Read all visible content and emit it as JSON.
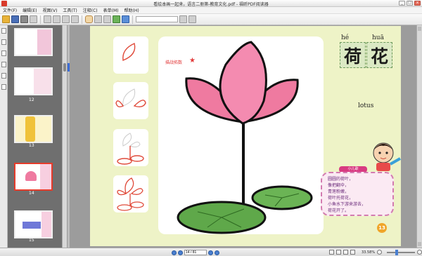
{
  "window": {
    "title": "看绘本画一起来，语言二册第-教育文化.pdf - 福昕PDF阅读器"
  },
  "menu": [
    "文件(F)",
    "编辑(E)",
    "视图(V)",
    "工具(T)",
    "注释(C)",
    "表单(M)",
    "帮助(H)"
  ],
  "toolbar": {
    "search_placeholder": ""
  },
  "thumbnails": [
    {
      "label": "11"
    },
    {
      "label": "12"
    },
    {
      "label": "13"
    },
    {
      "label": "14"
    },
    {
      "label": "15"
    }
  ],
  "page": {
    "badge": "描战拓数",
    "pinyin": [
      "hé",
      "huā"
    ],
    "hanzi": [
      "荷",
      "花"
    ],
    "english": "lotus",
    "poem_title": "小儿歌",
    "poem_lines": [
      "圆圆的荷叶，",
      "像把翻伞，",
      "青莲粉嫩，",
      "荷叶托荷花，",
      "小鱼水下游来游去，",
      "荷花开了。"
    ],
    "page_number": "13"
  },
  "status": {
    "page_field": "14 / 81",
    "zoom": "33.58%"
  },
  "colors": {
    "accent": "#e63b2a",
    "page_bg": "#eef3c7",
    "petal": "#ef7aa0",
    "leaf": "#5fa84a"
  }
}
